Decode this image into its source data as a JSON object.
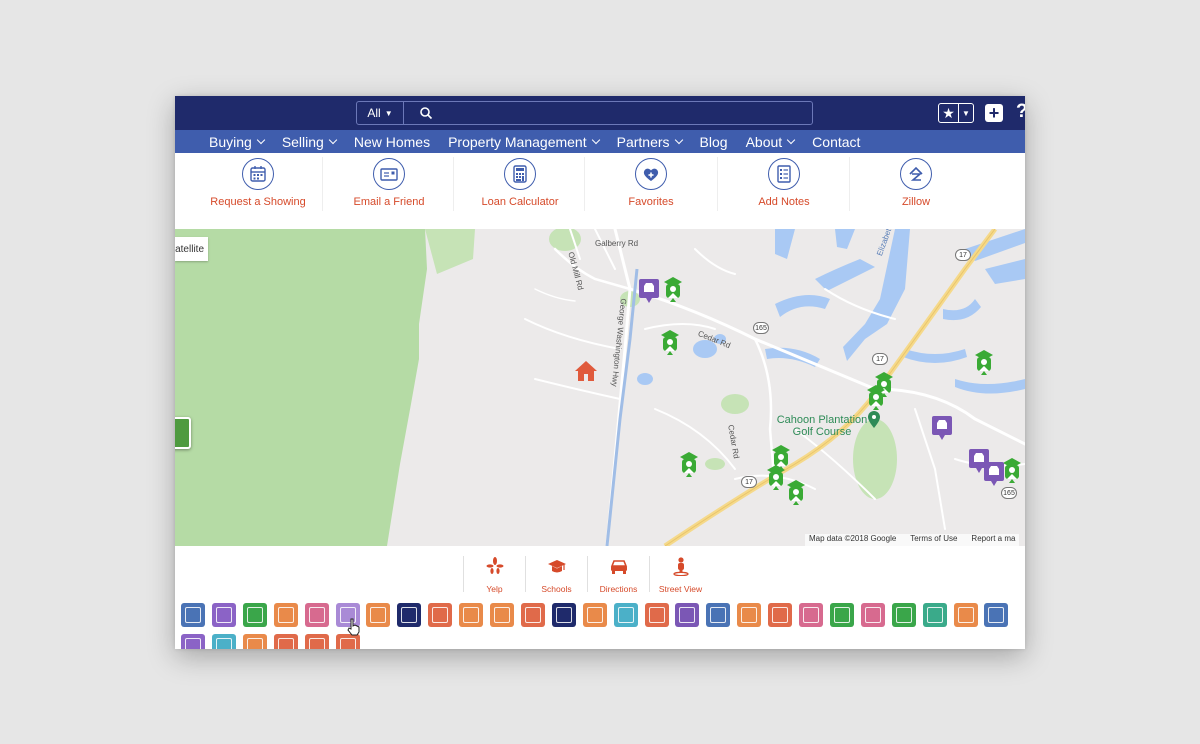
{
  "search": {
    "scope": "All",
    "placeholder": ""
  },
  "nav": [
    {
      "label": "Buying",
      "dropdown": true
    },
    {
      "label": "Selling",
      "dropdown": true
    },
    {
      "label": "New Homes",
      "dropdown": false
    },
    {
      "label": "Property Management",
      "dropdown": true
    },
    {
      "label": "Partners",
      "dropdown": true
    },
    {
      "label": "Blog",
      "dropdown": false
    },
    {
      "label": "About",
      "dropdown": true
    },
    {
      "label": "Contact",
      "dropdown": false
    }
  ],
  "tools": [
    {
      "label": "Request a Showing",
      "icon": "calendar-icon"
    },
    {
      "label": "Email a Friend",
      "icon": "envelope-icon"
    },
    {
      "label": "Loan Calculator",
      "icon": "calculator-icon"
    },
    {
      "label": "Favorites",
      "icon": "heart-plus-icon"
    },
    {
      "label": "Add Notes",
      "icon": "notes-icon"
    },
    {
      "label": "Zillow",
      "icon": "zillow-icon"
    }
  ],
  "map": {
    "satellite": "atellite",
    "roads": [
      "Galberry Rd",
      "Old Mill Rd",
      "George Washington Hwy",
      "Cedar Rd",
      "Cedar Rd",
      "Elizabeth River"
    ],
    "route_shields": [
      "17",
      "165",
      "17",
      "17",
      "165"
    ],
    "golf": "Cahoon Plantation Golf Course",
    "footer": {
      "data": "Map data ©2018 Google",
      "terms": "Terms of Use",
      "report": "Report a ma"
    }
  },
  "amenities": [
    {
      "label": "Yelp",
      "icon": "yelp-icon"
    },
    {
      "label": "Schools",
      "icon": "graduation-cap-icon"
    },
    {
      "label": "Directions",
      "icon": "car-icon"
    },
    {
      "label": "Street View",
      "icon": "pegman-icon"
    }
  ],
  "colors": {
    "topbar": "#1f2a6b",
    "nav": "#3f5dad",
    "accent": "#d64a2a",
    "school": "#3aaa35",
    "shop": "#7b57b5",
    "home": "#e05a3c"
  },
  "categories": [
    {
      "icon": "money-bag-icon",
      "color": "#4a73b5"
    },
    {
      "icon": "beer-icon",
      "color": "#8b63c6"
    },
    {
      "icon": "beach-icon",
      "color": "#3aa64a"
    },
    {
      "icon": "family-icon",
      "color": "#e98a4a"
    },
    {
      "icon": "cinema-icon",
      "color": "#d76a8f"
    },
    {
      "icon": "coffee-icon",
      "color": "#a98ad6"
    },
    {
      "icon": "bread-icon",
      "color": "#e98a4a"
    },
    {
      "icon": "car-icon",
      "color": "#1f2a6b"
    },
    {
      "icon": "cocktail-icon",
      "color": "#e06a4a"
    },
    {
      "icon": "drink-icon",
      "color": "#e98a4a"
    },
    {
      "icon": "bar-icon",
      "color": "#e98a4a"
    },
    {
      "icon": "fitness-icon",
      "color": "#e06a4a"
    },
    {
      "icon": "gas-station-icon",
      "color": "#1f2a6b"
    },
    {
      "icon": "shoe-icon",
      "color": "#e98a4a"
    },
    {
      "icon": "grocery-icon",
      "color": "#4bb0c8"
    },
    {
      "icon": "hospital-icon",
      "color": "#e06a4a"
    },
    {
      "icon": "hotel-icon",
      "color": "#7b57b5"
    },
    {
      "icon": "library-icon",
      "color": "#4a73b5"
    },
    {
      "icon": "taxi-icon",
      "color": "#e98a4a"
    },
    {
      "icon": "museum-icon",
      "color": "#e06a4a"
    },
    {
      "icon": "nightlife-icon",
      "color": "#d76a8f"
    },
    {
      "icon": "park-icon",
      "color": "#3aa64a"
    },
    {
      "icon": "theater-icon",
      "color": "#d76a8f"
    },
    {
      "icon": "pet-icon",
      "color": "#3aa64a"
    },
    {
      "icon": "hiking-icon",
      "color": "#3aaa8a"
    },
    {
      "icon": "playground-icon",
      "color": "#e98a4a"
    },
    {
      "icon": "police-icon",
      "color": "#4a73b5"
    },
    {
      "icon": "restaurant-icon",
      "color": "#8b63c6"
    },
    {
      "icon": "shopping-icon",
      "color": "#4bb0c8"
    },
    {
      "icon": "spa-icon",
      "color": "#e98a4a"
    },
    {
      "icon": "train-icon",
      "color": "#e06a4a"
    },
    {
      "icon": "tool-icon",
      "color": "#e06a4a"
    },
    {
      "icon": "bank-icon",
      "color": "#e06a4a"
    }
  ]
}
